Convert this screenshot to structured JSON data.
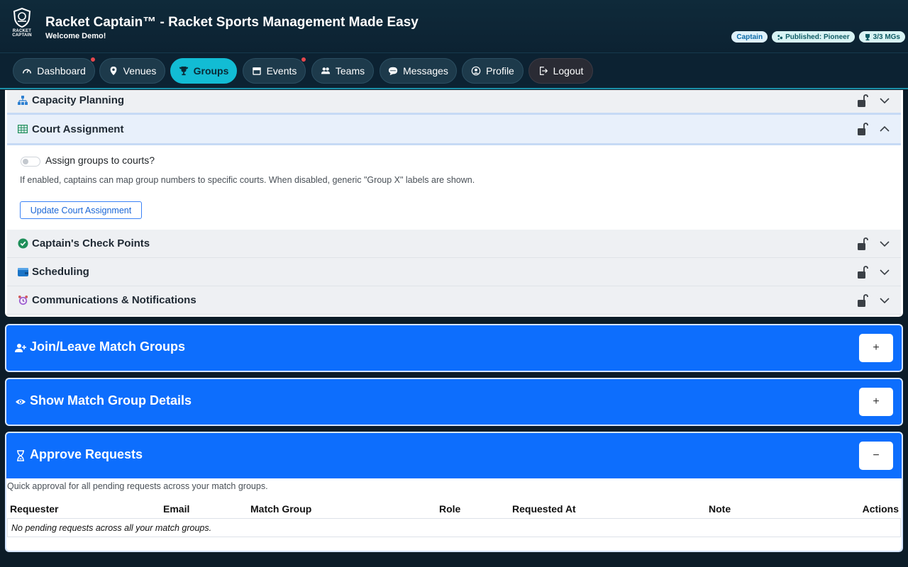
{
  "app": {
    "title": "Racket Captain™ - Racket Sports Management Made Easy",
    "welcome": "Welcome Demo!",
    "logo_text": "RACKET CAPTAIN"
  },
  "badges": [
    {
      "label": "Captain"
    },
    {
      "label": "Published: Pioneer"
    },
    {
      "label": "3/3 MGs"
    }
  ],
  "nav": [
    {
      "label": "Dashboard",
      "icon": "gauge-icon",
      "dot": true
    },
    {
      "label": "Venues",
      "icon": "map-pin-icon",
      "dot": false
    },
    {
      "label": "Groups",
      "icon": "trophy-icon",
      "dot": false,
      "active": true
    },
    {
      "label": "Events",
      "icon": "calendar-icon",
      "dot": true
    },
    {
      "label": "Teams",
      "icon": "people-icon",
      "dot": false
    },
    {
      "label": "Messages",
      "icon": "chat-icon",
      "dot": false
    },
    {
      "label": "Profile",
      "icon": "user-circle-icon",
      "dot": false
    },
    {
      "label": "Logout",
      "icon": "logout-icon",
      "dot": false
    }
  ],
  "settings": {
    "sections": [
      {
        "title": "Capacity Planning",
        "icon": "sitemap-icon",
        "expanded": false
      },
      {
        "title": "Court Assignment",
        "icon": "grid-icon",
        "expanded": true
      },
      {
        "title": "Captain's Check Points",
        "icon": "check-circle-icon",
        "expanded": false
      },
      {
        "title": "Scheduling",
        "icon": "wallet-icon",
        "expanded": false
      },
      {
        "title": "Communications & Notifications",
        "icon": "alarm-clock-icon",
        "expanded": false
      }
    ],
    "court_assignment": {
      "toggle_label": "Assign groups to courts?",
      "toggle_on": false,
      "help": "If enabled, captains can map group numbers to specific courts. When disabled, generic \"Group X\" labels are shown.",
      "button": "Update Court Assignment"
    }
  },
  "panels": {
    "join_leave": {
      "title": "Join/Leave Match Groups",
      "toggle": "+"
    },
    "show_details": {
      "title": "Show Match Group Details",
      "toggle": "+"
    },
    "approve": {
      "title": "Approve Requests",
      "toggle": "−",
      "description": "Quick approval for all pending requests across your match groups.",
      "columns": [
        "Requester",
        "Email",
        "Match Group",
        "Role",
        "Requested At",
        "Note",
        "Actions"
      ],
      "empty": "No pending requests across all your match groups."
    }
  },
  "colors": {
    "accent": "#12bcd4",
    "primary": "#0d6efd",
    "notification_dot": "#e5484d"
  }
}
